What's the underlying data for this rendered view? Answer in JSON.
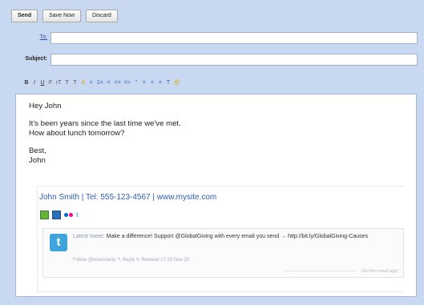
{
  "toolbar": {
    "send_label": "Send",
    "save_label": "Save Now",
    "discard_label": "Discard"
  },
  "compose": {
    "to_label": "To:",
    "to_value": "",
    "subject_label": "Subject:",
    "subject_value": ""
  },
  "format_toolbar": [
    "B",
    "I",
    "U",
    "F",
    "rT",
    "T",
    "T",
    "A",
    "=",
    "1=",
    "=",
    "<=",
    "=>",
    "“",
    "=",
    "=",
    "=",
    "T",
    "@"
  ],
  "message": {
    "greeting": "Hey John",
    "line1": "It's been years since the last time we've met.",
    "line2": "How about lunch tomorrow?",
    "closing": "Best,",
    "name": "John"
  },
  "signature": {
    "line": "John Smith | Tel: 555-123-4567 | www.mysite.com",
    "social_icons": [
      "myspace-icon",
      "linkedin-icon",
      "flickr-icon",
      "twitter-icon"
    ],
    "tweet": {
      "prefix": "Latest tweet:",
      "text": "Make a difference! Support @GlobalGiving with every email you send → http://bit.ly/GlobalGiving-Causes",
      "meta": "Follow @wisestamp  ↰ Reply  ↻ Retweet   17:29 Nov-20",
      "promo": "Get this email app!"
    }
  },
  "colors": {
    "background": "#c9d8f1",
    "link": "#2e5db4",
    "twitter": "#3ea4db"
  }
}
